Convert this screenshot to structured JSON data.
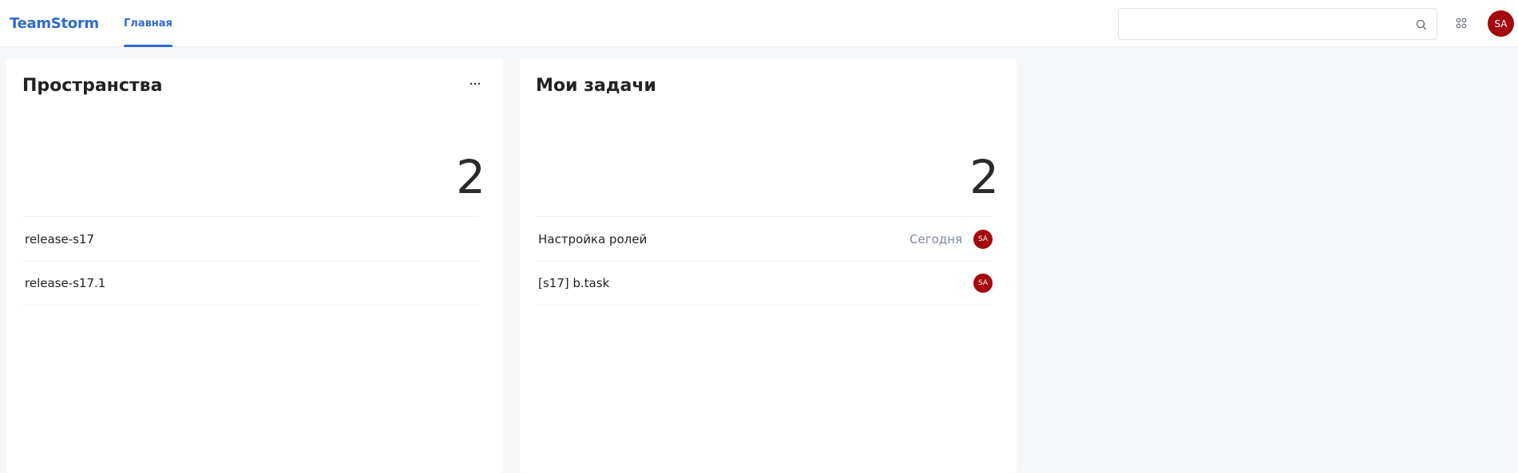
{
  "header": {
    "logo": "TeamStorm",
    "nav_tab": "Главная",
    "search": {
      "value": "",
      "placeholder": ""
    },
    "search_icon": "search-icon",
    "apps_icon": "apps-grid-icon",
    "user_initials": "SA"
  },
  "spaces": {
    "title": "Пространства",
    "more_icon": "more-horizontal-icon",
    "count": "2",
    "items": [
      {
        "label": "release-s17"
      },
      {
        "label": "release-s17.1"
      }
    ]
  },
  "tasks": {
    "title": "Мои задачи",
    "count": "2",
    "items": [
      {
        "label": "Настройка ролей",
        "date": "Сегодня",
        "assignee": "SA"
      },
      {
        "label": "[s17] b.task",
        "date": "",
        "assignee": "SA"
      }
    ]
  },
  "colors": {
    "brand": "#2f6ad0",
    "avatar": "#a5080d",
    "background": "#f6f7f9"
  }
}
